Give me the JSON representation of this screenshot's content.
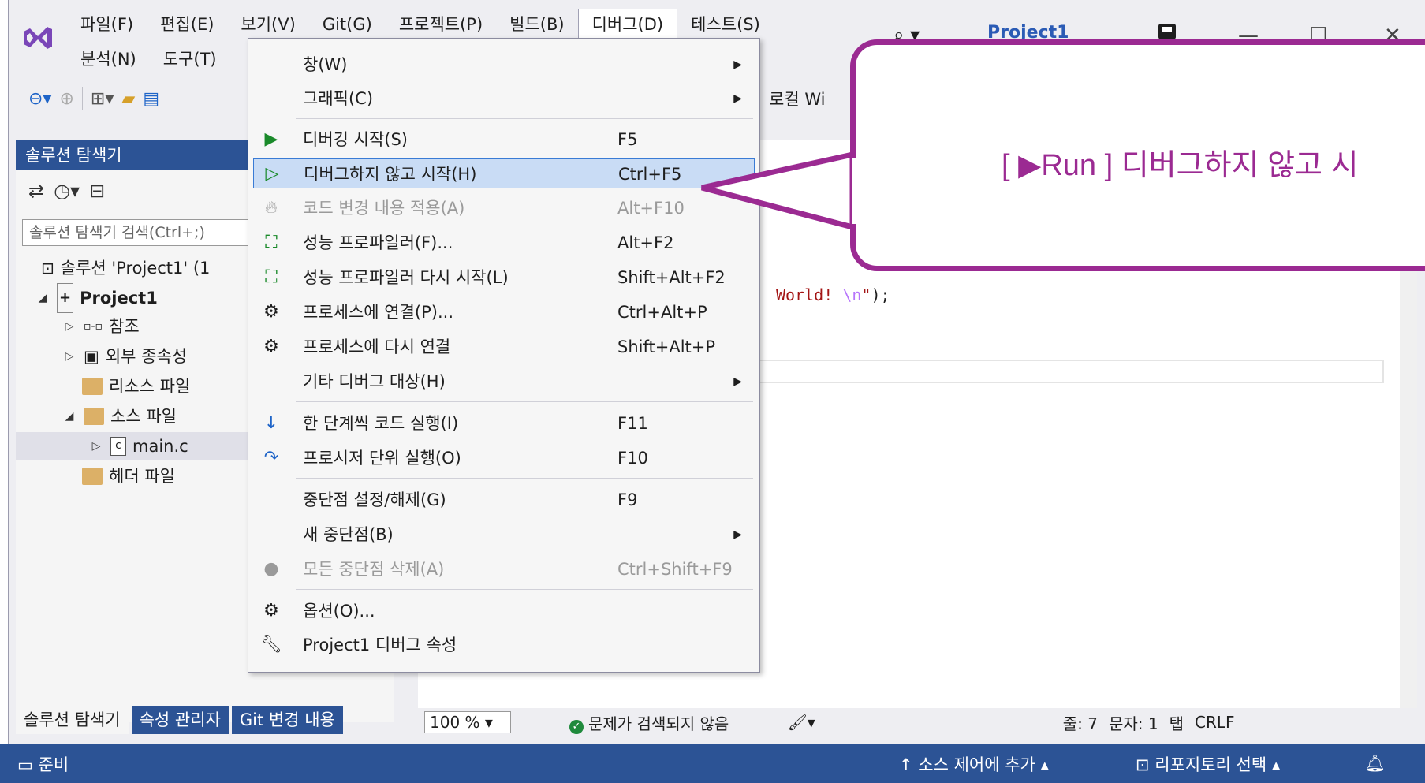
{
  "menubar": {
    "row1": [
      "파일(F)",
      "편집(E)",
      "보기(V)",
      "Git(G)",
      "프로젝트(P)",
      "빌드(B)",
      "디버그(D)",
      "테스트(S)"
    ],
    "row2": [
      "분석(N)",
      "도구(T)"
    ],
    "search_icon": "search-icon",
    "solution_title": "Project1"
  },
  "toolbar": {
    "local_windows": "로컬 Wi"
  },
  "solution_explorer": {
    "title": "솔루션 탐색기",
    "search_placeholder": "솔루션 탐색기 검색(Ctrl+;)",
    "tree": [
      {
        "label": "솔루션 'Project1' (1",
        "bold": false
      },
      {
        "label": "Project1",
        "bold": true
      },
      {
        "label": "참조",
        "bold": false
      },
      {
        "label": "외부 종속성",
        "bold": false
      },
      {
        "label": "리소스 파일",
        "bold": false
      },
      {
        "label": "소스 파일",
        "bold": false
      },
      {
        "label": "main.c",
        "bold": false
      },
      {
        "label": "헤더 파일",
        "bold": false
      }
    ],
    "bottom_tabs": [
      "솔루션 탐색기",
      "속성 관리자",
      "Git 변경 내용"
    ]
  },
  "editor": {
    "code_fragment": "World! ",
    "code_escape": "\\n",
    "code_tail": "\");",
    "code_quote": "\"",
    "zoom": "100 %",
    "issues": "문제가 검색되지 않음",
    "line": "줄: 7",
    "char": "문자: 1",
    "tab": "탭",
    "eol": "CRLF"
  },
  "statusbar": {
    "ready": "준비",
    "source_control": "소스 제어에 추가",
    "repo": "리포지토리 선택"
  },
  "debug_menu": [
    {
      "label": "창(W)",
      "shortcut": "",
      "submenu": true,
      "icon": "",
      "disabled": false
    },
    {
      "label": "그래픽(C)",
      "shortcut": "",
      "submenu": true,
      "icon": "",
      "disabled": false
    },
    {
      "label": "디버깅 시작(S)",
      "shortcut": "F5",
      "submenu": false,
      "icon": "play-icon",
      "disabled": false
    },
    {
      "label": "디버그하지 않고 시작(H)",
      "shortcut": "Ctrl+F5",
      "submenu": false,
      "icon": "play-outline-icon",
      "disabled": false,
      "highlight": true
    },
    {
      "label": "코드 변경 내용 적용(A)",
      "shortcut": "Alt+F10",
      "submenu": false,
      "icon": "flame-icon",
      "disabled": true
    },
    {
      "label": "성능 프로파일러(F)...",
      "shortcut": "Alt+F2",
      "submenu": false,
      "icon": "profiler-icon",
      "disabled": false
    },
    {
      "label": "성능 프로파일러 다시 시작(L)",
      "shortcut": "Shift+Alt+F2",
      "submenu": false,
      "icon": "profiler-icon",
      "disabled": false
    },
    {
      "label": "프로세스에 연결(P)...",
      "shortcut": "Ctrl+Alt+P",
      "submenu": false,
      "icon": "gears-icon",
      "disabled": false
    },
    {
      "label": "프로세스에 다시 연결",
      "shortcut": "Shift+Alt+P",
      "submenu": false,
      "icon": "gears-icon",
      "disabled": false
    },
    {
      "label": "기타 디버그 대상(H)",
      "shortcut": "",
      "submenu": true,
      "icon": "",
      "disabled": false
    },
    {
      "label": "한 단계씩 코드 실행(I)",
      "shortcut": "F11",
      "submenu": false,
      "icon": "step-into-icon",
      "disabled": false
    },
    {
      "label": "프로시저 단위 실행(O)",
      "shortcut": "F10",
      "submenu": false,
      "icon": "step-over-icon",
      "disabled": false
    },
    {
      "label": "중단점 설정/해제(G)",
      "shortcut": "F9",
      "submenu": false,
      "icon": "",
      "disabled": false
    },
    {
      "label": "새 중단점(B)",
      "shortcut": "",
      "submenu": true,
      "icon": "",
      "disabled": false
    },
    {
      "label": "모든 중단점 삭제(A)",
      "shortcut": "Ctrl+Shift+F9",
      "submenu": false,
      "icon": "delete-breakpoints-icon",
      "disabled": true
    },
    {
      "label": "옵션(O)...",
      "shortcut": "",
      "submenu": false,
      "icon": "gear-icon",
      "disabled": false
    },
    {
      "label": "Project1 디버그 속성",
      "shortcut": "",
      "submenu": false,
      "icon": "wrench-icon",
      "disabled": false
    }
  ],
  "callout": {
    "text": "[ ▶Run ] 디버그하지 않고 시"
  },
  "colors": {
    "accent": "#9b2a92",
    "brand_blue": "#2c5395",
    "highlight": "#c9dcf5"
  }
}
